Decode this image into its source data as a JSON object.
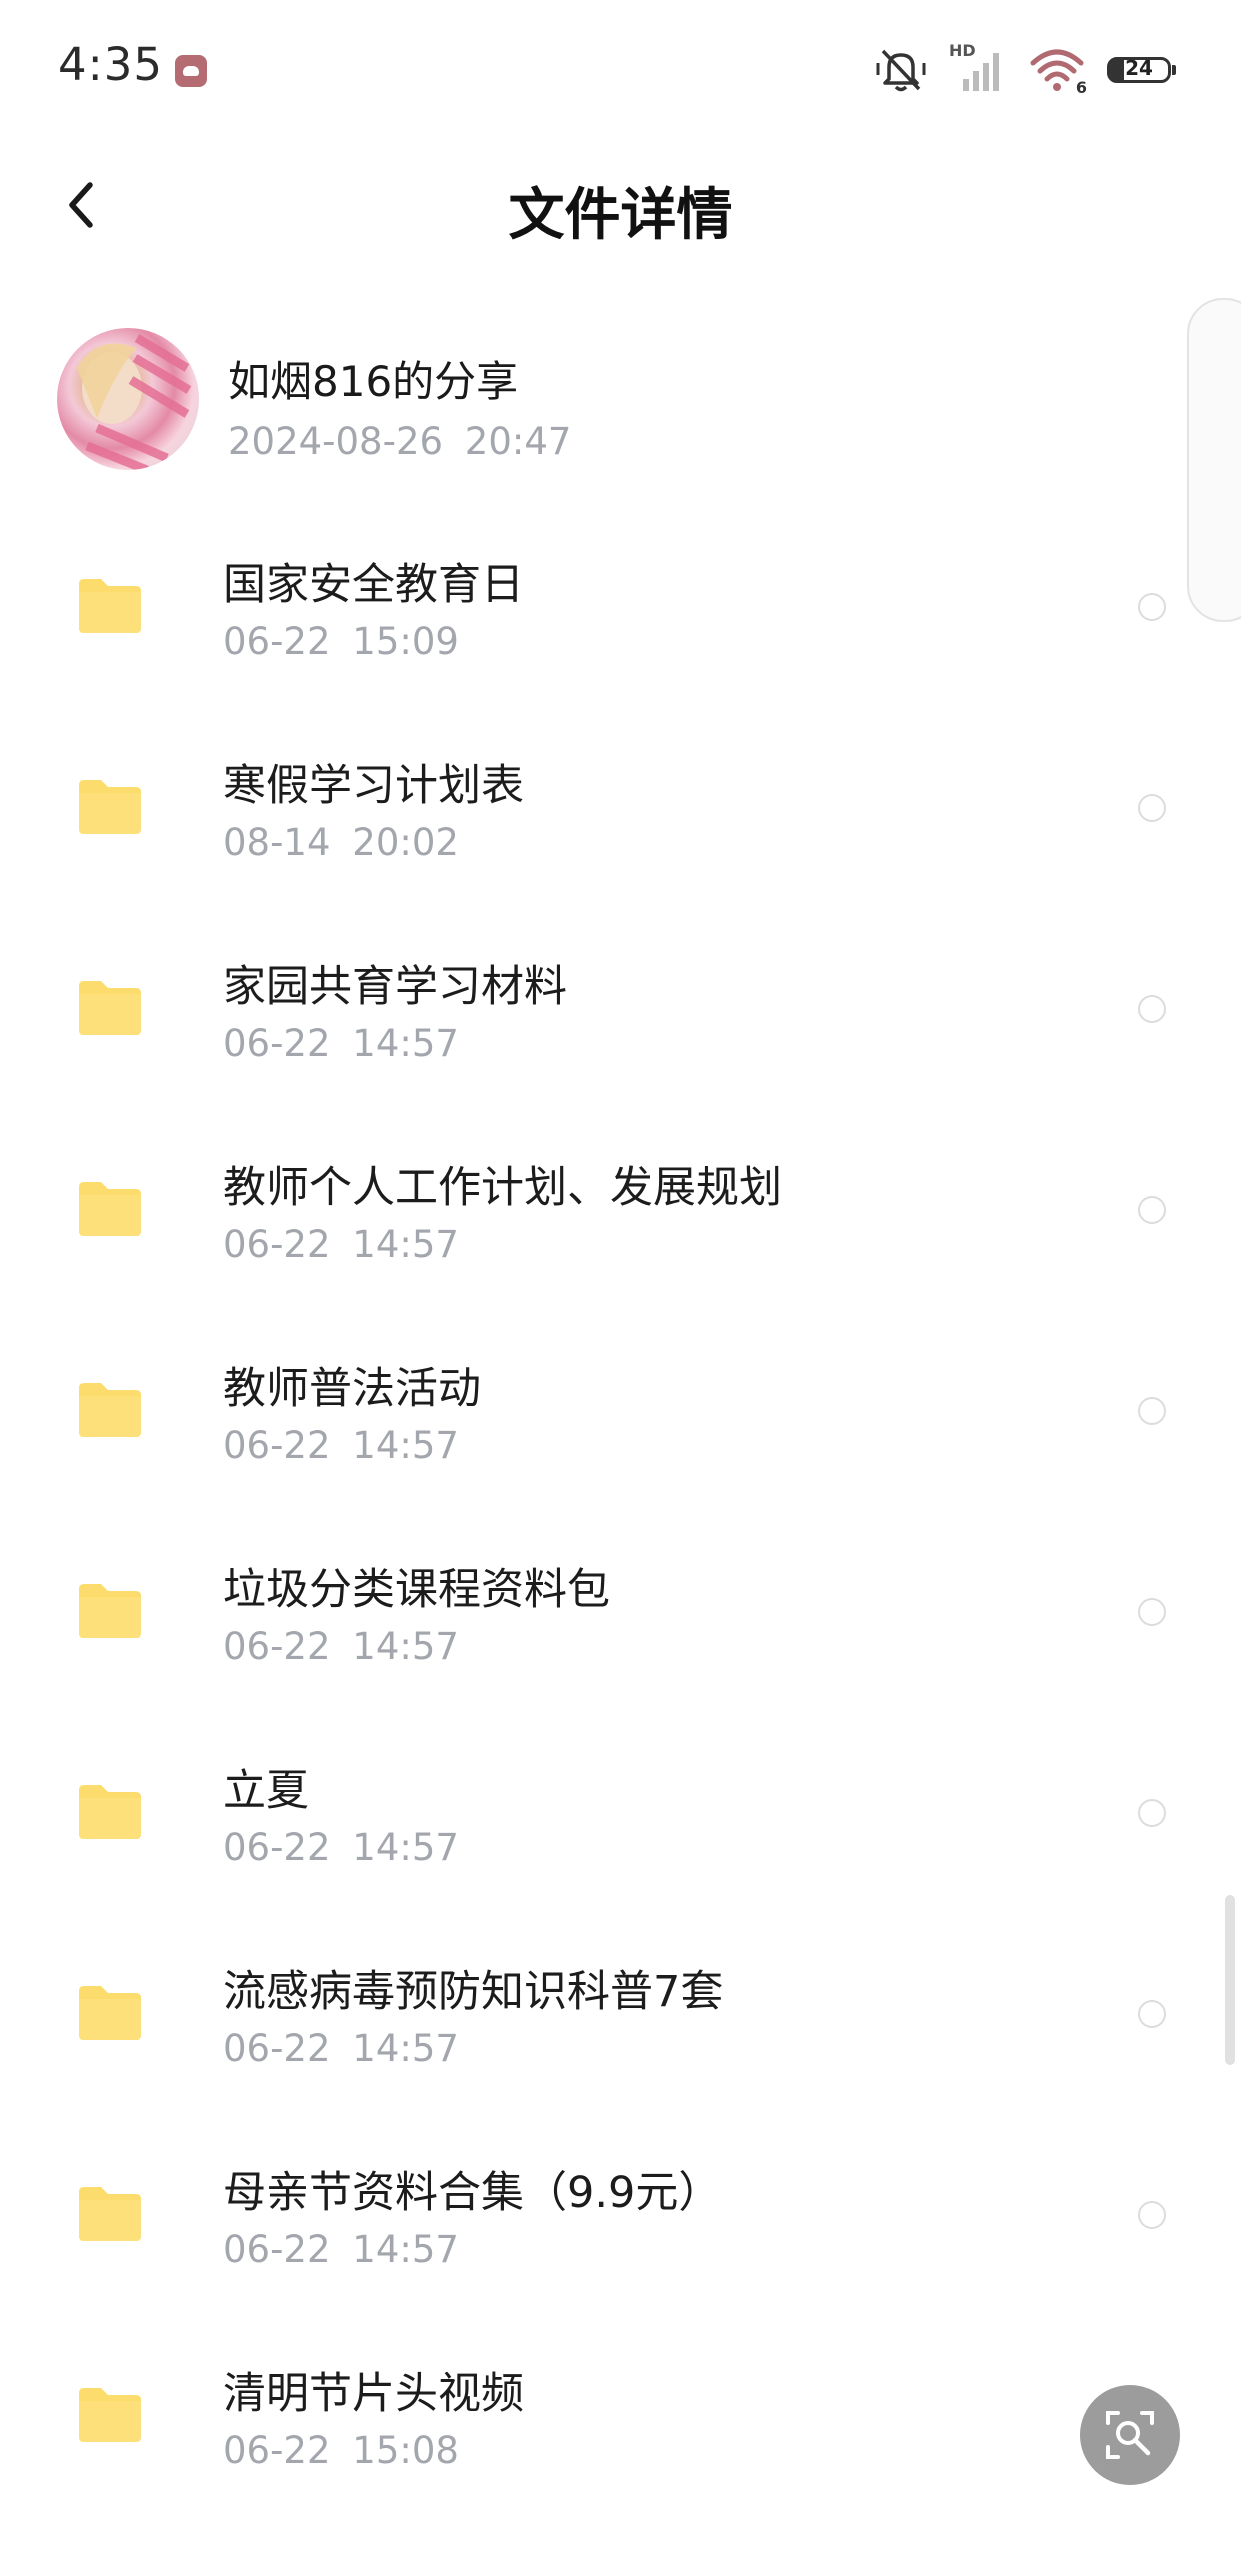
{
  "status_bar": {
    "time": "4:35",
    "network_label": "HD",
    "wifi_label": "6",
    "battery": "24",
    "battery_fraction": 0.24,
    "app_icon": "cloud-app-icon"
  },
  "header": {
    "title": "文件详情",
    "back_icon": "chevron-left-icon"
  },
  "sharer": {
    "name": "如烟816的分享",
    "date": "2024-08-26  20:47"
  },
  "files": [
    {
      "name": "国家安全教育日",
      "date": "06-22  15:09"
    },
    {
      "name": "寒假学习计划表",
      "date": "08-14  20:02"
    },
    {
      "name": "家园共育学习材料",
      "date": "06-22  14:57"
    },
    {
      "name": "教师个人工作计划、发展规划",
      "date": "06-22  14:57"
    },
    {
      "name": "教师普法活动",
      "date": "06-22  14:57"
    },
    {
      "name": "垃圾分类课程资料包",
      "date": "06-22  14:57"
    },
    {
      "name": "立夏",
      "date": "06-22  14:57"
    },
    {
      "name": "流感病毒预防知识科普7套",
      "date": "06-22  14:57"
    },
    {
      "name": "母亲节资料合集（9.9元）",
      "date": "06-22  14:57"
    },
    {
      "name": "清明节片头视频",
      "date": "06-22  15:08"
    }
  ],
  "icons": {
    "folder": "folder-icon",
    "search": "image-search-icon"
  },
  "colors": {
    "folder": "#FCDC6C",
    "secondary_text": "#A3A7AD",
    "fab": "#9C9C9C"
  }
}
